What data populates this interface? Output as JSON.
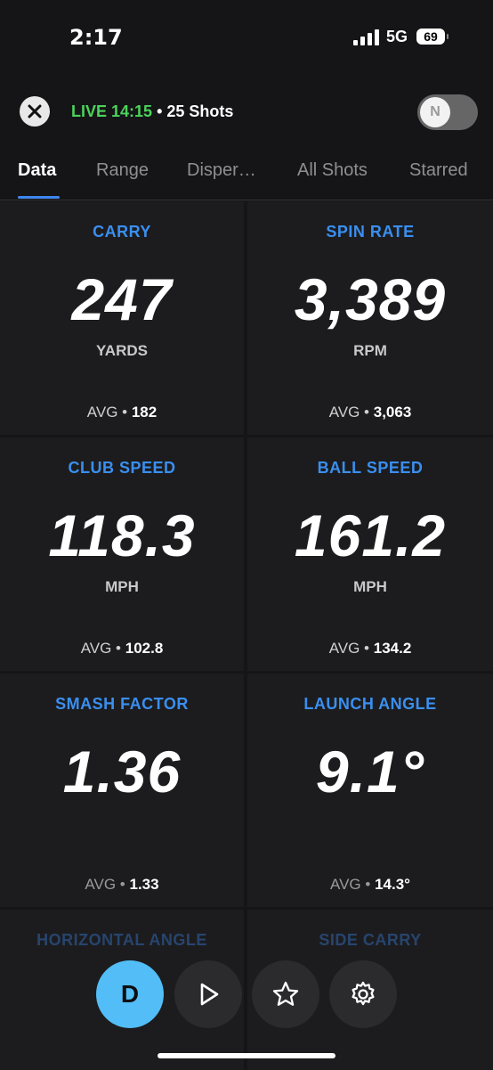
{
  "status": {
    "time": "2:17",
    "network": "5G",
    "battery": "69"
  },
  "header": {
    "live_label": "LIVE 14:15",
    "separator": "•",
    "shots": "25 Shots",
    "toggle_label": "N"
  },
  "tabs": [
    {
      "label": "Data"
    },
    {
      "label": "Range"
    },
    {
      "label": "Disper…"
    },
    {
      "label": "All Shots"
    },
    {
      "label": "Starred"
    }
  ],
  "metrics": [
    {
      "label": "CARRY",
      "value": "247",
      "unit": "YARDS",
      "avg_label": "AVG •",
      "avg": "182"
    },
    {
      "label": "SPIN RATE",
      "value": "3,389",
      "unit": "RPM",
      "avg_label": "AVG •",
      "avg": "3,063"
    },
    {
      "label": "CLUB SPEED",
      "value": "118.3",
      "unit": "MPH",
      "avg_label": "AVG •",
      "avg": "102.8"
    },
    {
      "label": "BALL SPEED",
      "value": "161.2",
      "unit": "MPH",
      "avg_label": "AVG •",
      "avg": "134.2"
    },
    {
      "label": "SMASH FACTOR",
      "value": "1.36",
      "unit": "",
      "avg_label": "AVG •",
      "avg": "1.33"
    },
    {
      "label": "LAUNCH ANGLE",
      "value": "9.1°",
      "unit": "",
      "avg_label": "AVG •",
      "avg": "14.3°"
    },
    {
      "label": "HORIZONTAL ANGLE"
    },
    {
      "label": "SIDE CARRY"
    }
  ],
  "fab": {
    "primary_label": "D",
    "icons": [
      "play-icon",
      "star-icon",
      "gear-icon"
    ]
  },
  "colors": {
    "accent": "#3a8ff0",
    "live": "#4bd35a",
    "primary_fab": "#52bdf7"
  }
}
